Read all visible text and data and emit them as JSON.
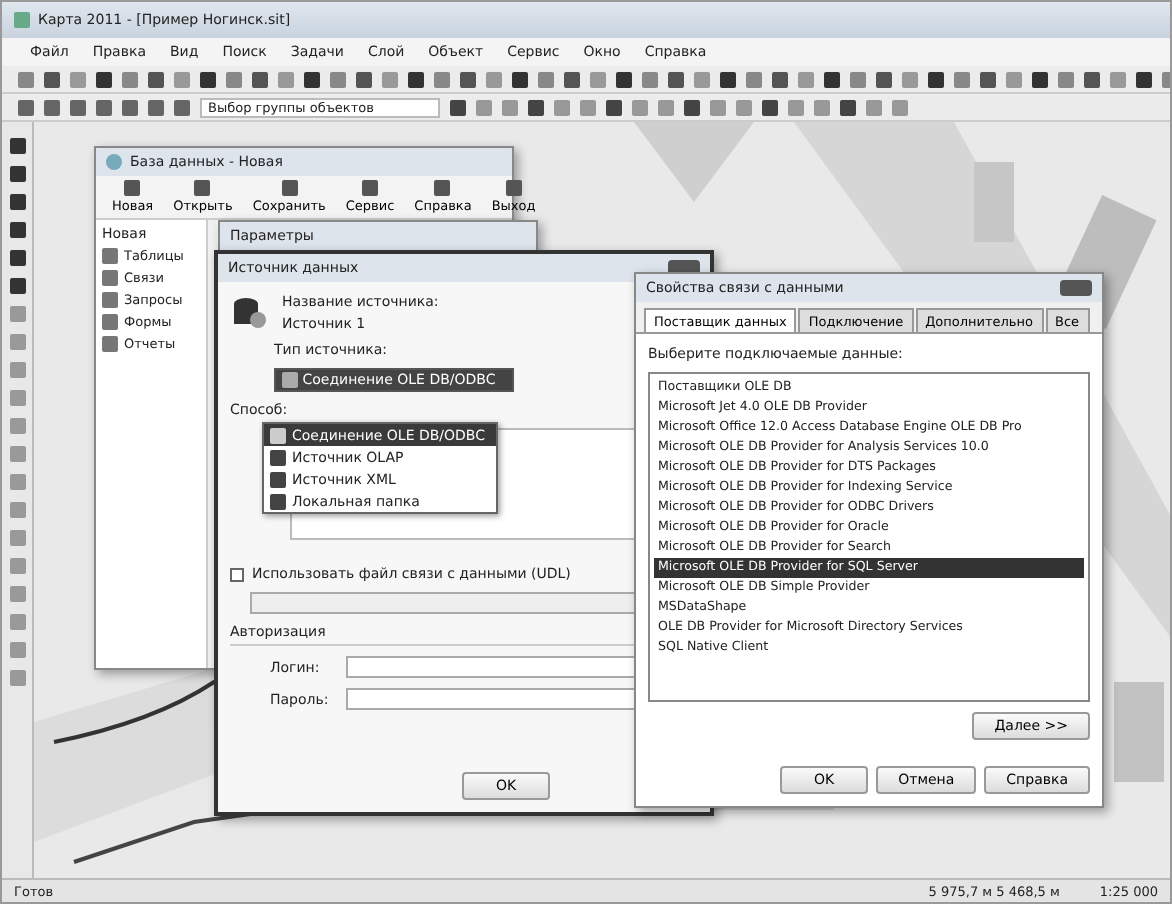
{
  "window": {
    "title": "Карта 2011 - [Пример Ногинск.sit]"
  },
  "menu": [
    "Файл",
    "Правка",
    "Вид",
    "Поиск",
    "Задачи",
    "Слой",
    "Объект",
    "Сервис",
    "Окно",
    "Справка"
  ],
  "layer_field": {
    "value": "Выбор группы объектов"
  },
  "database_window": {
    "title": "База данных - Новая",
    "toolbar": [
      "Новая",
      "Открыть",
      "Сохранить",
      "Сервис",
      "Справка",
      "Выход"
    ],
    "tree_header": "Новая",
    "items": [
      "Таблицы",
      "Связи",
      "Запросы",
      "Формы",
      "Отчеты"
    ],
    "back_panel": {
      "title": "Параметры"
    }
  },
  "source_dialog": {
    "title": "Источник данных",
    "name_label": "Название источника:",
    "name_value": "Источник 1",
    "type_label": "Тип источника:",
    "type_value": "Соединение OLE DB/ODBC",
    "type_options": [
      {
        "label": "Соединение OLE DB/ODBC",
        "selected": true
      },
      {
        "label": "Источник OLAP",
        "selected": false
      },
      {
        "label": "Источник XML",
        "selected": false
      },
      {
        "label": "Локальная папка",
        "selected": false
      }
    ],
    "method_label": "Способ:",
    "udl": {
      "label": "Использовать файл связи с данными (UDL)",
      "checked": false
    },
    "auth_label": "Авторизация",
    "login_label": "Логин:",
    "password_label": "Пароль:",
    "buttons": [
      "OK"
    ]
  },
  "link_dialog": {
    "title": "Свойства связи с данными",
    "tabs": [
      {
        "label": "Поставщик данных",
        "selected": true
      },
      {
        "label": "Подключение",
        "selected": false
      },
      {
        "label": "Дополнительно",
        "selected": false
      },
      {
        "label": "Все",
        "selected": false
      }
    ],
    "prompt": "Выберите подключаемые данные:",
    "providers": [
      {
        "label": "Поставщики OLE DB",
        "selected": false
      },
      {
        "label": "Microsoft Jet 4.0 OLE DB Provider",
        "selected": false
      },
      {
        "label": "Microsoft Office 12.0 Access Database Engine OLE DB Pro",
        "selected": false
      },
      {
        "label": "Microsoft OLE DB Provider for Analysis Services 10.0",
        "selected": false
      },
      {
        "label": "Microsoft OLE DB Provider for DTS Packages",
        "selected": false
      },
      {
        "label": "Microsoft OLE DB Provider for Indexing Service",
        "selected": false
      },
      {
        "label": "Microsoft OLE DB Provider for ODBC Drivers",
        "selected": false
      },
      {
        "label": "Microsoft OLE DB Provider for Oracle",
        "selected": false
      },
      {
        "label": "Microsoft OLE DB Provider for Search",
        "selected": false
      },
      {
        "label": "Microsoft OLE DB Provider for SQL Server",
        "selected": true
      },
      {
        "label": "Microsoft OLE DB Simple Provider",
        "selected": false
      },
      {
        "label": "MSDataShape",
        "selected": false
      },
      {
        "label": "OLE DB Provider for Microsoft Directory Services",
        "selected": false
      },
      {
        "label": "SQL Native Client",
        "selected": false
      }
    ],
    "next_button": "Далее >>",
    "buttons": [
      "OK",
      "Отмена",
      "Справка"
    ]
  },
  "status_bar": {
    "left": "Готов",
    "coords": "5 975,7 м  5 468,5 м",
    "scale": "1:25 000"
  }
}
